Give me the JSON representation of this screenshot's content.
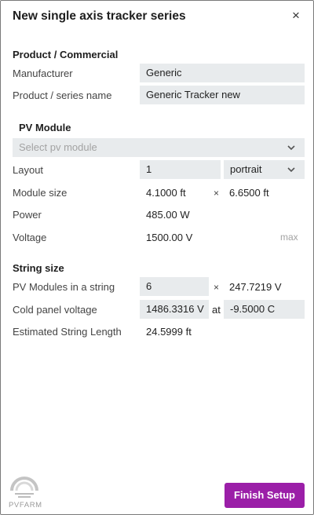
{
  "dialog": {
    "title": "New single axis tracker series",
    "close_glyph": "×"
  },
  "product": {
    "section_title": "Product / Commercial",
    "manufacturer_label": "Manufacturer",
    "manufacturer_value": "Generic",
    "series_name_label": "Product / series name",
    "series_name_value": "Generic Tracker new"
  },
  "pv_module": {
    "section_title": "PV Module",
    "select_placeholder": "Select pv module",
    "layout_label": "Layout",
    "layout_count": "1",
    "layout_orientation": "portrait",
    "module_size_label": "Module size",
    "module_width": "4.1000 ft",
    "module_height": "6.6500 ft",
    "times_glyph": "×",
    "power_label": "Power",
    "power_value": "485.00 W",
    "voltage_label": "Voltage",
    "voltage_value": "1500.00 V",
    "voltage_note": "max"
  },
  "string_size": {
    "section_title": "String size",
    "modules_label": "PV Modules in a string",
    "modules_value": "6",
    "times_glyph": "×",
    "string_voltage": "247.7219 V",
    "cold_label": "Cold panel voltage",
    "cold_value": "1486.3316 V",
    "at_label": "at",
    "cold_temp": "-9.5000 C",
    "length_label": "Estimated String Length",
    "length_value": "24.5999 ft"
  },
  "footer": {
    "logo_text": "PVFARM",
    "finish_label": "Finish Setup",
    "brand_color": "#9b1fa8"
  },
  "icons": {
    "close": "close-icon",
    "select_chevron": "chevron-down-icon",
    "logo": "pvfarm-logo-icon"
  }
}
